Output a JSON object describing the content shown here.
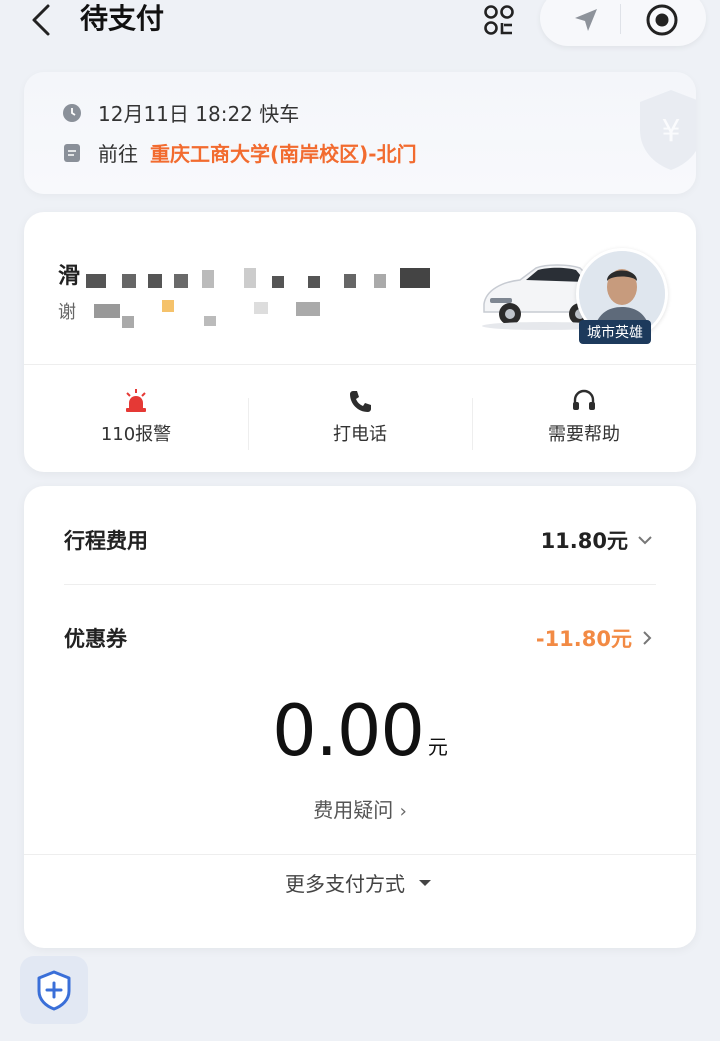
{
  "header": {
    "title": "待支付"
  },
  "trip": {
    "datetime": "12月11日 18:22 快车",
    "to_prefix": "前往",
    "destination": "重庆工商大学(南岸校区)-北门"
  },
  "driver": {
    "name_visible": "滑",
    "sub_visible": "谢",
    "badge": "城市英雄"
  },
  "actions": [
    {
      "label": "110报警",
      "icon": "alarm-icon"
    },
    {
      "label": "打电话",
      "icon": "phone-icon"
    },
    {
      "label": "需要帮助",
      "icon": "headset-icon"
    }
  ],
  "fare": {
    "trip_cost_label": "行程费用",
    "trip_cost_value": "11.80元",
    "coupon_label": "优惠券",
    "coupon_value": "-11.80元",
    "total_amount": "0.00",
    "total_unit": "元",
    "fee_question": "费用疑问",
    "more_payment": "更多支付方式"
  },
  "colors": {
    "accent_orange": "#f26b2f",
    "coupon_orange": "#f28a44",
    "alarm_red": "#e53935",
    "badge_navy": "#1d3a5c",
    "shield_blue": "#3a6fd8"
  }
}
